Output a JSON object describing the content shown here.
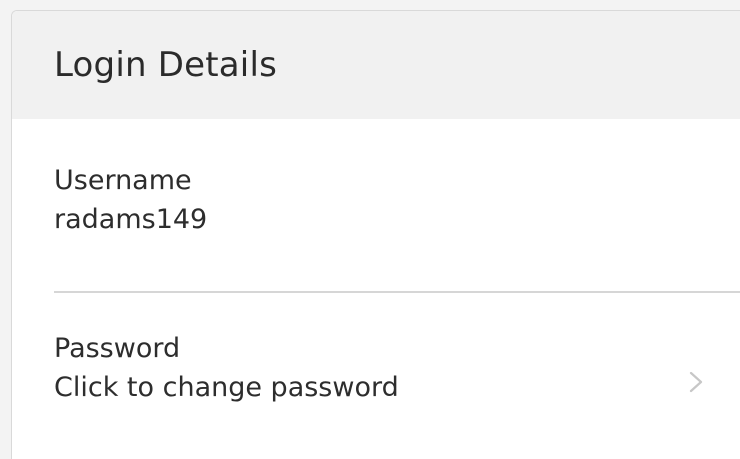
{
  "card": {
    "title": "Login Details"
  },
  "username": {
    "label": "Username",
    "value": "radams149"
  },
  "password": {
    "label": "Password",
    "action_text": "Click to change password"
  },
  "icons": {
    "chevron": "chevron-right-icon"
  },
  "colors": {
    "header_bg": "#f1f1f1",
    "text": "#2d2d2d",
    "divider": "#d6d6d6",
    "chevron": "#c7c7c7"
  }
}
